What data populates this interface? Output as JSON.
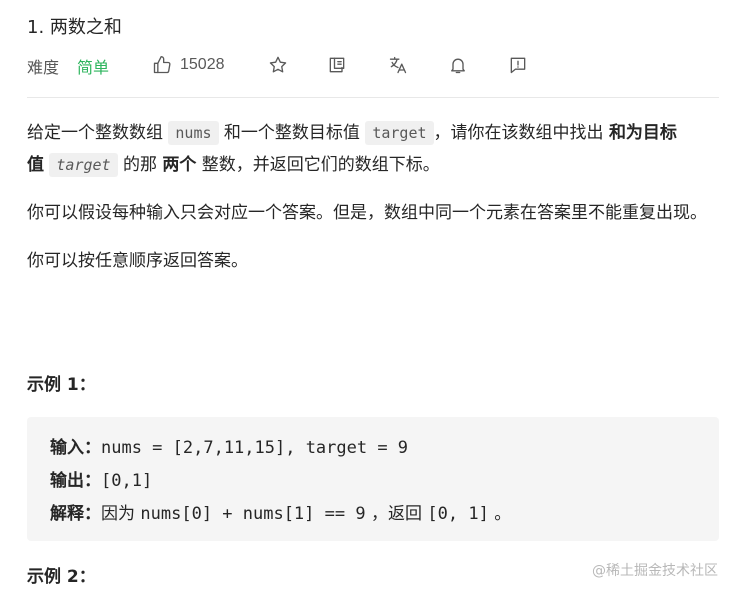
{
  "problem": {
    "title": "1. 两数之和"
  },
  "meta": {
    "difficulty_label": "难度",
    "difficulty_value": "简单",
    "like_count": "15028",
    "icons": [
      "thumbs-up-icon",
      "star-icon",
      "share-icon",
      "translate-icon",
      "bell-icon",
      "feedback-icon"
    ],
    "colors": {
      "difficulty_easy": "#2db55d"
    }
  },
  "description": {
    "p1": {
      "t1": "给定一个整数数组 ",
      "c1": "nums",
      "t2": " 和一个整数目标值 ",
      "c2": "target",
      "t3": "，请你在该数组中找出 ",
      "b1": "和为目标值",
      "c3": "target",
      "t4": " 的那 ",
      "b2": "两个",
      "t5": " 整数，并返回它们的数组下标。"
    },
    "p2": "你可以假设每种输入只会对应一个答案。但是，数组中同一个元素在答案里不能重复出现。",
    "p3": "你可以按任意顺序返回答案。"
  },
  "example1": {
    "title": "示例 1：",
    "input_label": "输入：",
    "input_value": "nums = [2,7,11,15], target = 9",
    "output_label": "输出：",
    "output_value": "[0,1]",
    "explain_label": "解释：",
    "explain_t1": "因为 ",
    "explain_c1": "nums[0] + nums[1] == 9",
    "explain_t2": " ，返回 ",
    "explain_c2": "[0, 1]",
    "explain_t3": " 。"
  },
  "example2": {
    "title": "示例 2："
  },
  "watermark": "@稀土掘金技术社区"
}
